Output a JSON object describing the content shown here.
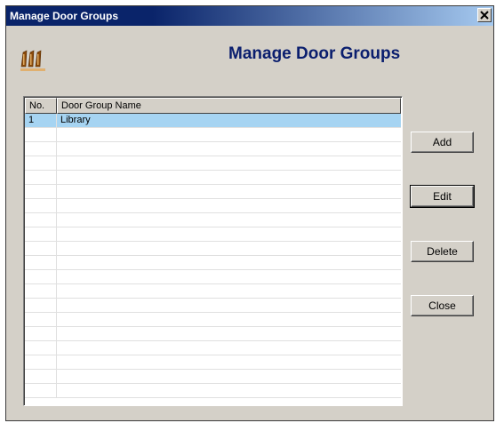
{
  "window": {
    "title": "Manage Door Groups",
    "close_glyph": "×"
  },
  "dialog": {
    "heading": "Manage Door Groups",
    "icon": "door-group-icon"
  },
  "table": {
    "columns": [
      "No.",
      "Door Group Name"
    ],
    "rows": [
      {
        "no": "1",
        "name": "Library",
        "selected": true
      }
    ],
    "empty_rows": 19,
    "selection_color": "#a6d4f2"
  },
  "buttons": {
    "add": "Add",
    "edit": "Edit",
    "delete": "Delete",
    "close": "Close"
  },
  "colors": {
    "titlebar": "#0a246a",
    "heading": "#0a1e6e",
    "face": "#d4d0c8"
  }
}
